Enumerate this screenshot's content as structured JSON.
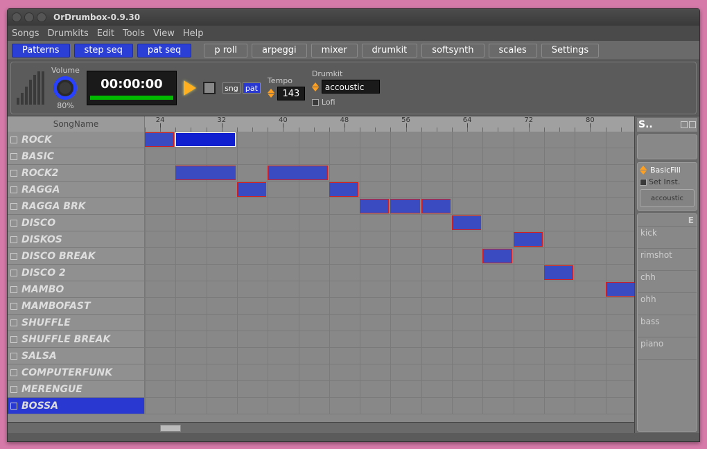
{
  "window": {
    "title": "OrDrumbox-0.9.30"
  },
  "menu": [
    "Songs",
    "Drumkits",
    "Edit",
    "Tools",
    "View",
    "Help"
  ],
  "toolbar": [
    {
      "label": "Patterns",
      "active": true
    },
    {
      "label": "step seq",
      "active": true
    },
    {
      "label": "pat seq",
      "active": true
    },
    {
      "label": "p roll",
      "active": false
    },
    {
      "label": "arpeggi",
      "active": false
    },
    {
      "label": "mixer",
      "active": false
    },
    {
      "label": "drumkit",
      "active": false
    },
    {
      "label": "softsynth",
      "active": false
    },
    {
      "label": "scales",
      "active": false
    },
    {
      "label": "Settings",
      "active": false
    }
  ],
  "transport": {
    "volume_label": "Volume",
    "volume_value": "80%",
    "time": "00:00:00",
    "mode": {
      "sng": "sng",
      "pat": "pat",
      "active": "pat"
    },
    "tempo_label": "Tempo",
    "tempo": "143",
    "drumkit_label": "Drumkit",
    "drumkit": "accoustic",
    "lofi_label": "Lofi"
  },
  "ruler": {
    "songname_label": "SongName",
    "marks": [
      24,
      32,
      40,
      48,
      56,
      64,
      72,
      80
    ]
  },
  "tracks": [
    "ROCK",
    "BASIC",
    "ROCK2",
    "RAGGA",
    "RAGGA BRK",
    "DISCO",
    "DISKOS",
    "DISCO BREAK",
    "DISCO 2",
    "MAMBO",
    "MAMBOFAST",
    "SHUFFLE",
    "SHUFFLE BREAK",
    "SALSA",
    "COMPUTERFUNK",
    "MERENGUE",
    "BOSSA"
  ],
  "selected_track_index": 16,
  "clips": [
    {
      "row": 0,
      "col": 0,
      "len": 1,
      "sel": false
    },
    {
      "row": 0,
      "col": 1,
      "len": 2,
      "sel": true
    },
    {
      "row": 2,
      "col": 1,
      "len": 2,
      "sel": false
    },
    {
      "row": 2,
      "col": 4,
      "len": 2,
      "sel": false
    },
    {
      "row": 3,
      "col": 3,
      "len": 1,
      "sel": false
    },
    {
      "row": 3,
      "col": 6,
      "len": 1,
      "sel": false
    },
    {
      "row": 4,
      "col": 7,
      "len": 1,
      "sel": false
    },
    {
      "row": 4,
      "col": 8,
      "len": 1,
      "sel": false
    },
    {
      "row": 4,
      "col": 9,
      "len": 1,
      "sel": false
    },
    {
      "row": 5,
      "col": 10,
      "len": 1,
      "sel": false
    },
    {
      "row": 6,
      "col": 12,
      "len": 1,
      "sel": false
    },
    {
      "row": 7,
      "col": 11,
      "len": 1,
      "sel": false
    },
    {
      "row": 8,
      "col": 13,
      "len": 1,
      "sel": false
    },
    {
      "row": 9,
      "col": 15,
      "len": 1,
      "sel": false
    }
  ],
  "side": {
    "header": "S..",
    "basicfill_label": "BasicFill",
    "set_inst_label": "Set Inst.",
    "accoustic_btn": "accoustic",
    "list_header": "E",
    "instruments": [
      "kick",
      "rimshot",
      "chh",
      "ohh",
      "bass",
      "piano"
    ]
  }
}
